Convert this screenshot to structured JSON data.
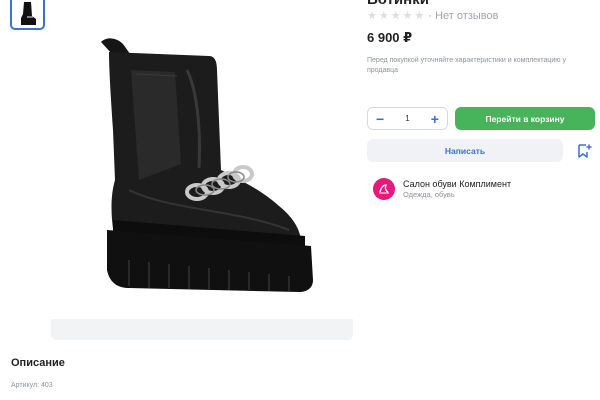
{
  "product": {
    "title": "Ботинки",
    "rating_stars": 0,
    "reviews_text": "Нет отзывов",
    "price": "6 900 ₽",
    "note": "Перед покупкой уточняйте характеристики и комплектацию у продавца"
  },
  "cart": {
    "minus_label": "−",
    "quantity": "1",
    "plus_label": "+",
    "go_to_cart_label": "Перейти в корзину",
    "write_label": "Написать"
  },
  "seller": {
    "name": "Салон обуви Комплимент",
    "category": "Одежда, обувь"
  },
  "description": {
    "title": "Описание",
    "article": "Артикул: 403"
  },
  "icons": {
    "star": "star-icon",
    "bookmark": "bookmark-plus-icon",
    "seller_logo": "seller-logo-icon"
  },
  "colors": {
    "accent_blue": "#3d6fd6",
    "cart_green": "#47b35b",
    "seller_pink": "#e6197d"
  }
}
